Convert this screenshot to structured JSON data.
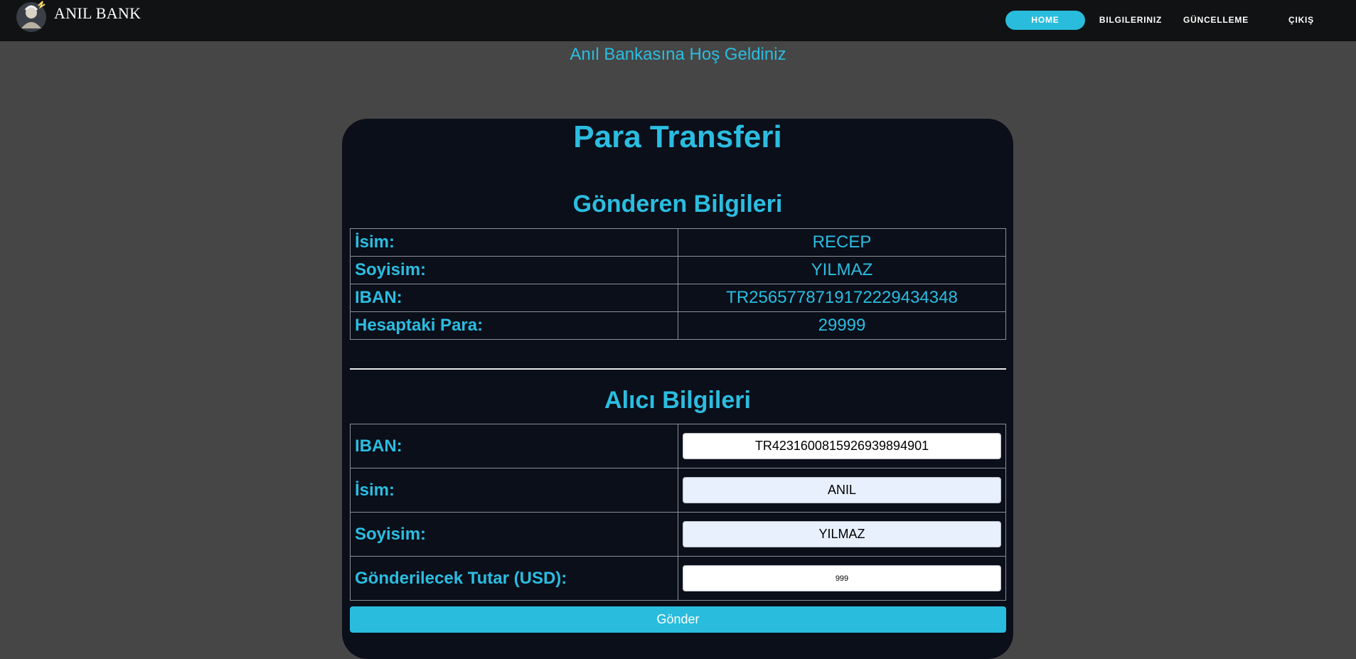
{
  "brand": {
    "name": "ANIL BANK",
    "logo_icon": "zeus-logo-icon"
  },
  "nav": {
    "home": "HOME",
    "info": "BILGILERINIZ",
    "update": "GÜNCELLEME",
    "exit": "ÇIKIŞ"
  },
  "welcome": "Anıl Bankasına Hoş Geldiniz",
  "card": {
    "title": "Para Transferi",
    "sender": {
      "title": "Gönderen Bilgileri",
      "rows": [
        {
          "label": "İsim:",
          "value": "RECEP"
        },
        {
          "label": "Soyisim:",
          "value": "YILMAZ"
        },
        {
          "label": "IBAN:",
          "value": "TR256577871917222943434​8"
        },
        {
          "label": "Hesaptaki Para:",
          "value": "29999"
        }
      ]
    },
    "receiver": {
      "title": "Alıcı Bilgileri",
      "iban_label": "IBAN:",
      "iban_value": "TR423160081592693989490​1",
      "name_label": "İsim:",
      "name_value": "ANIL",
      "surname_label": "Soyisim:",
      "surname_value": "YILMAZ",
      "amount_label": "Gönderilecek Tutar (USD):",
      "amount_value": "999"
    },
    "submit": "Gönder"
  },
  "colors": {
    "accent": "#29bcdc",
    "navbar": "#111213",
    "background": "#464646",
    "card": "#0a0f1a"
  }
}
